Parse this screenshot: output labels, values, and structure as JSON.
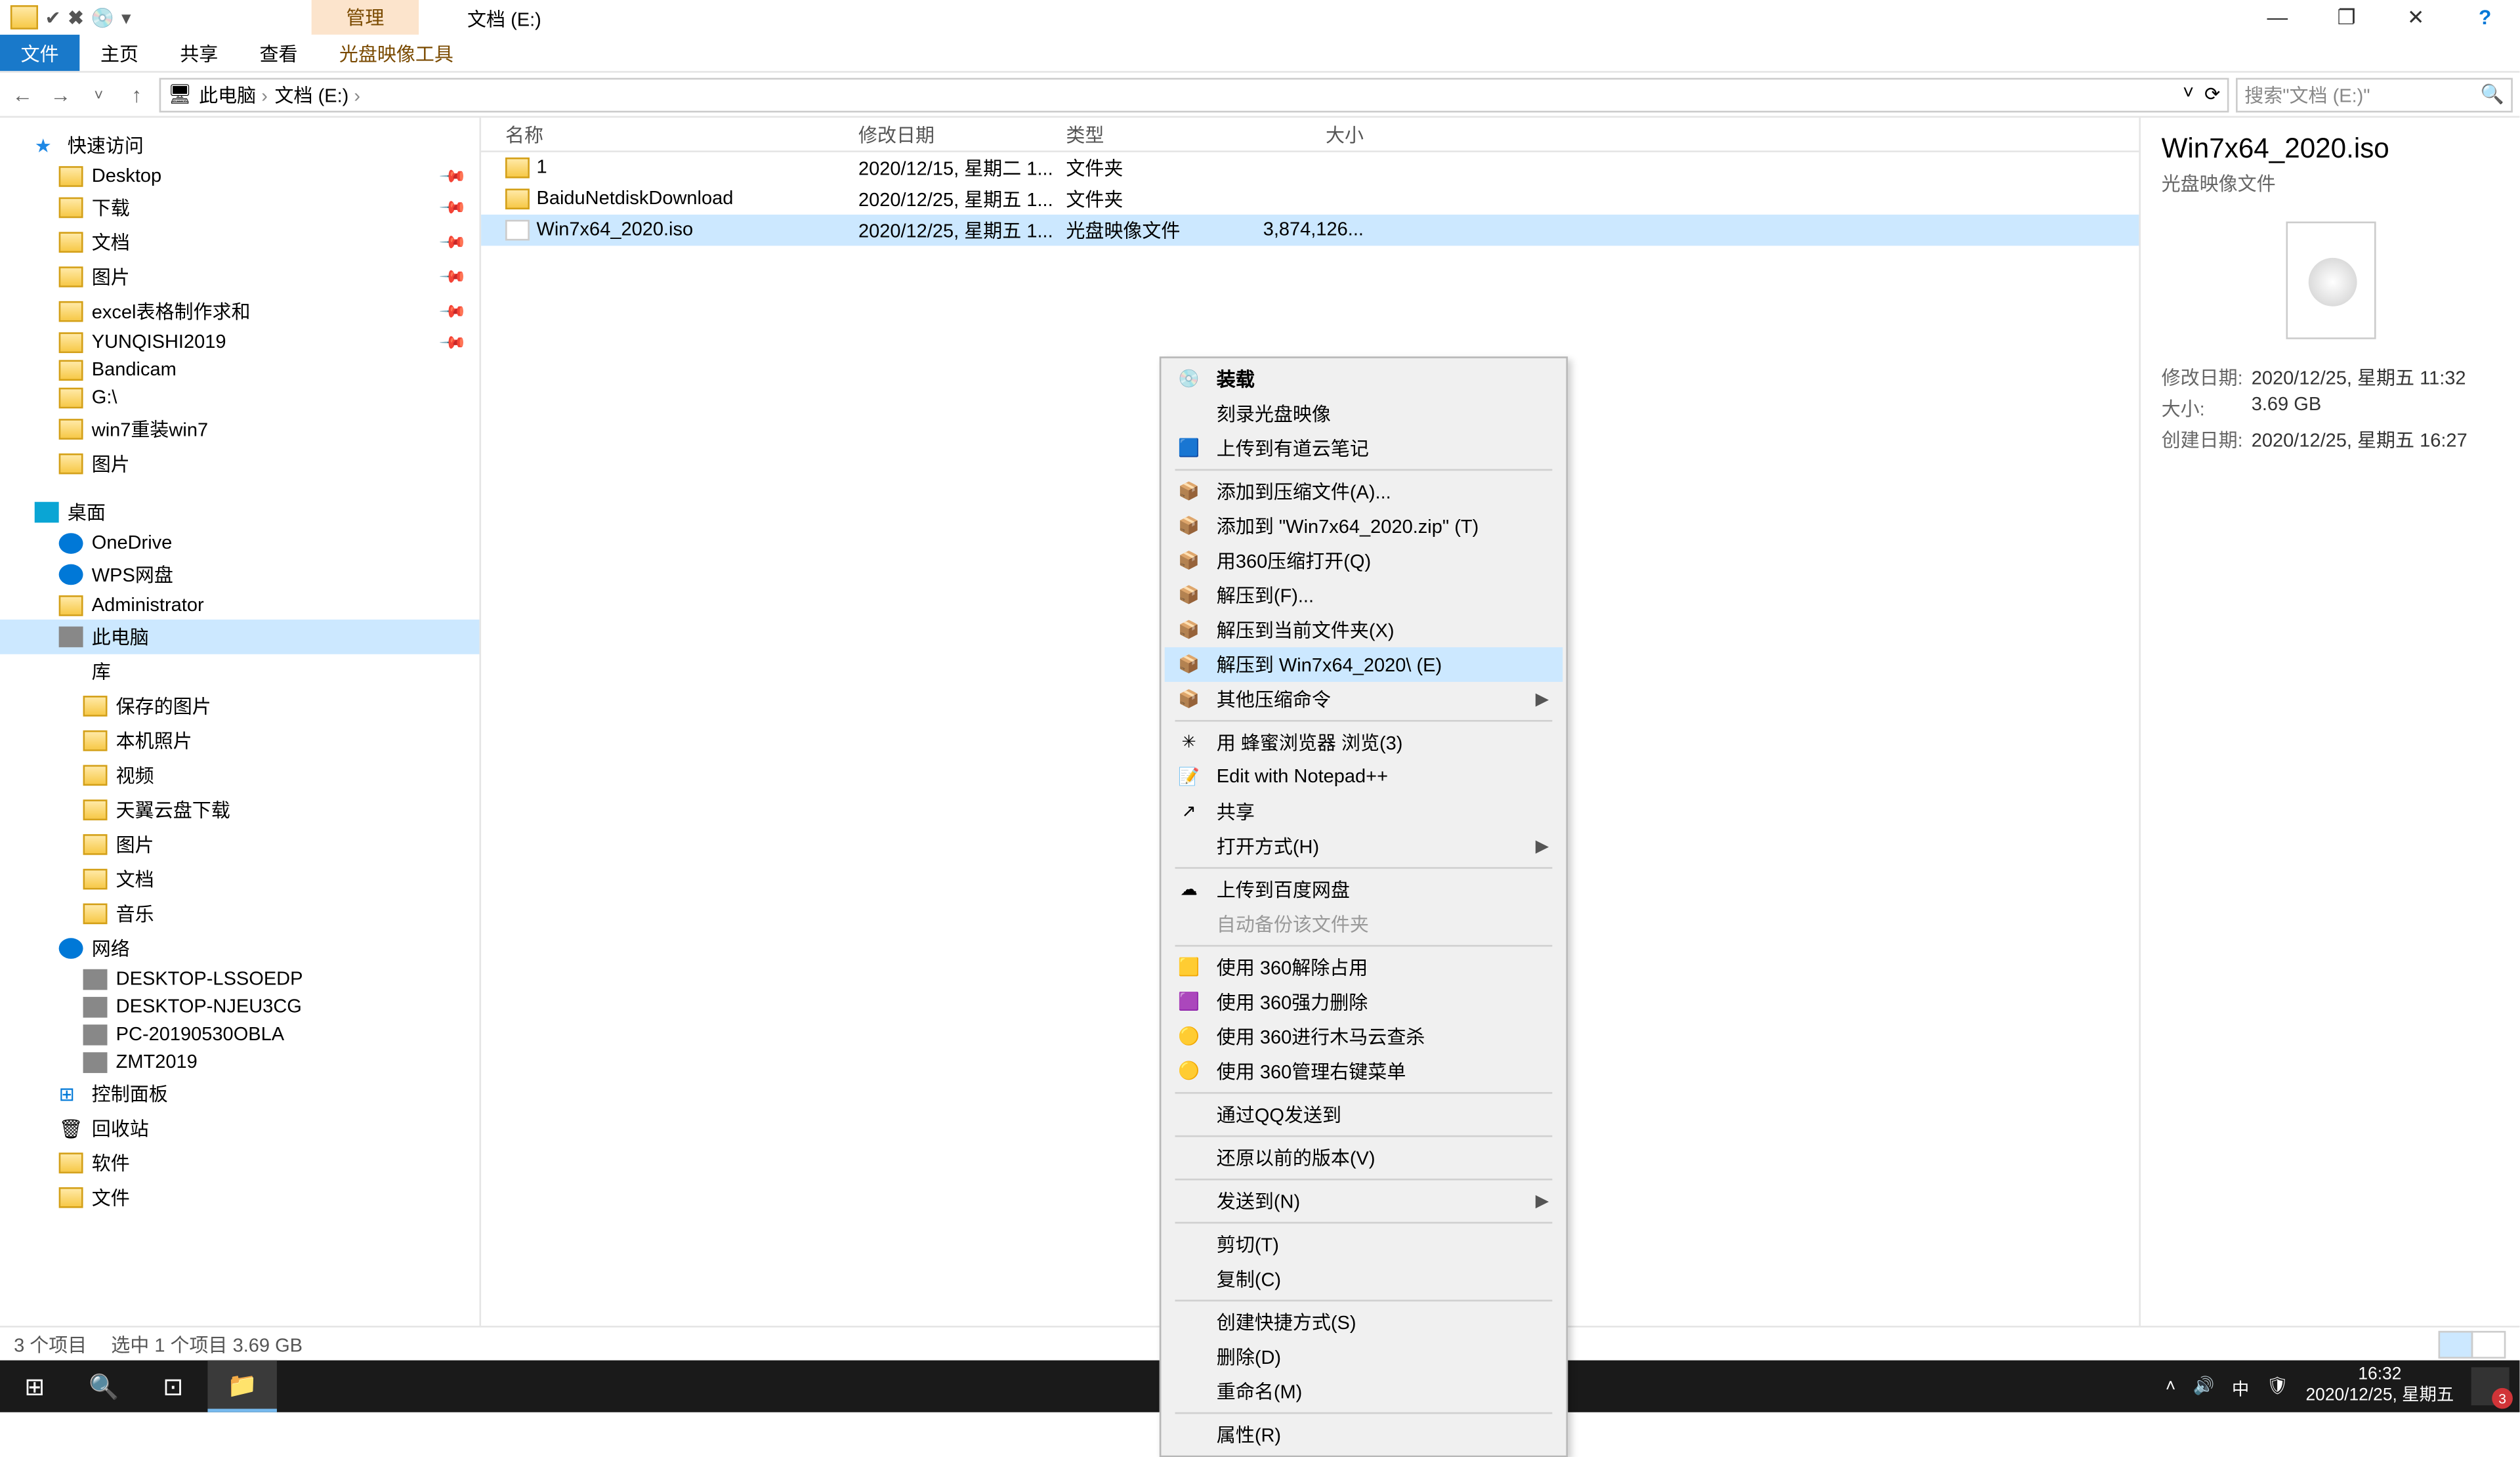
{
  "titlebar": {
    "manage_tab": "管理",
    "title": "文档 (E:)",
    "minimize": "—",
    "maximize": "❐",
    "close": "✕",
    "help": "?"
  },
  "ribbon": {
    "file": "文件",
    "home": "主页",
    "share": "共享",
    "view": "查看",
    "tool": "光盘映像工具"
  },
  "address": {
    "back": "←",
    "forward": "→",
    "up": "↑",
    "crumbs": [
      "此电脑",
      "文档 (E:)"
    ],
    "refresh": "⟳",
    "dropdown": "˅"
  },
  "search": {
    "placeholder": "搜索\"文档 (E:)\""
  },
  "tree": {
    "quick": "快速访问",
    "quick_items": [
      {
        "label": "Desktop",
        "pin": true
      },
      {
        "label": "下载",
        "pin": true
      },
      {
        "label": "文档",
        "pin": true
      },
      {
        "label": "图片",
        "pin": true
      },
      {
        "label": "excel表格制作求和",
        "pin": true
      },
      {
        "label": "YUNQISHI2019",
        "pin": true
      },
      {
        "label": "Bandicam"
      },
      {
        "label": "G:\\"
      },
      {
        "label": "win7重装win7"
      },
      {
        "label": "图片"
      }
    ],
    "desktop": "桌面",
    "desktop_items": [
      {
        "label": "OneDrive",
        "ico": "cloud"
      },
      {
        "label": "WPS网盘",
        "ico": "cloud"
      },
      {
        "label": "Administrator",
        "ico": "fold"
      },
      {
        "label": "此电脑",
        "ico": "pc",
        "sel": true
      },
      {
        "label": "库",
        "ico": "lib"
      }
    ],
    "lib_items": [
      {
        "label": "保存的图片"
      },
      {
        "label": "本机照片"
      },
      {
        "label": "视频"
      },
      {
        "label": "天翼云盘下载"
      },
      {
        "label": "图片"
      },
      {
        "label": "文档"
      },
      {
        "label": "音乐"
      }
    ],
    "network": "网络",
    "net_items": [
      "DESKTOP-LSSOEDP",
      "DESKTOP-NJEU3CG",
      "PC-20190530OBLA",
      "ZMT2019"
    ],
    "panel": "控制面板",
    "recycle": "回收站",
    "soft": "软件",
    "files": "文件"
  },
  "columns": {
    "name": "名称",
    "date": "修改日期",
    "type": "类型",
    "size": "大小"
  },
  "rows": [
    {
      "name": "1",
      "date": "2020/12/15, 星期二 1...",
      "type": "文件夹",
      "size": "",
      "ico": "fold"
    },
    {
      "name": "BaiduNetdiskDownload",
      "date": "2020/12/25, 星期五 1...",
      "type": "文件夹",
      "size": "",
      "ico": "fold"
    },
    {
      "name": "Win7x64_2020.iso",
      "date": "2020/12/25, 星期五 1...",
      "type": "光盘映像文件",
      "size": "3,874,126...",
      "ico": "iso",
      "sel": true
    }
  ],
  "ctx": {
    "items": [
      {
        "label": "装载",
        "bold": true,
        "ico": "💿",
        "sep": false
      },
      {
        "label": "刻录光盘映像"
      },
      {
        "label": "上传到有道云笔记",
        "ico": "🟦"
      },
      {
        "sep": true
      },
      {
        "label": "添加到压缩文件(A)...",
        "ico": "📦"
      },
      {
        "label": "添加到 \"Win7x64_2020.zip\" (T)",
        "ico": "📦"
      },
      {
        "label": "用360压缩打开(Q)",
        "ico": "📦"
      },
      {
        "label": "解压到(F)...",
        "ico": "📦"
      },
      {
        "label": "解压到当前文件夹(X)",
        "ico": "📦"
      },
      {
        "label": "解压到 Win7x64_2020\\ (E)",
        "ico": "📦",
        "hov": true
      },
      {
        "label": "其他压缩命令",
        "ico": "📦",
        "arrow": true
      },
      {
        "sep": true
      },
      {
        "label": "用 蜂蜜浏览器 浏览(3)",
        "ico": "✳"
      },
      {
        "label": "Edit with Notepad++",
        "ico": "📝"
      },
      {
        "label": "共享",
        "ico": "↗"
      },
      {
        "label": "打开方式(H)",
        "arrow": true
      },
      {
        "sep": true
      },
      {
        "label": "上传到百度网盘",
        "ico": "☁"
      },
      {
        "label": "自动备份该文件夹",
        "dis": true
      },
      {
        "sep": true
      },
      {
        "label": "使用 360解除占用",
        "ico": "🟨"
      },
      {
        "label": "使用 360强力删除",
        "ico": "🟪"
      },
      {
        "label": "使用 360进行木马云查杀",
        "ico": "🟡"
      },
      {
        "label": "使用 360管理右键菜单",
        "ico": "🟡"
      },
      {
        "sep": true
      },
      {
        "label": "通过QQ发送到"
      },
      {
        "sep": true
      },
      {
        "label": "还原以前的版本(V)"
      },
      {
        "sep": true
      },
      {
        "label": "发送到(N)",
        "arrow": true
      },
      {
        "sep": true
      },
      {
        "label": "剪切(T)"
      },
      {
        "label": "复制(C)"
      },
      {
        "sep": true
      },
      {
        "label": "创建快捷方式(S)"
      },
      {
        "label": "删除(D)"
      },
      {
        "label": "重命名(M)"
      },
      {
        "sep": true
      },
      {
        "label": "属性(R)"
      }
    ]
  },
  "details": {
    "title": "Win7x64_2020.iso",
    "type": "光盘映像文件",
    "rows": [
      {
        "lab": "修改日期:",
        "val": "2020/12/25, 星期五 11:32"
      },
      {
        "lab": "大小:",
        "val": "3.69 GB"
      },
      {
        "lab": "创建日期:",
        "val": "2020/12/25, 星期五 16:27"
      }
    ]
  },
  "status": {
    "count": "3 个项目",
    "sel": "选中 1 个项目  3.69 GB"
  },
  "taskbar": {
    "time": "16:32",
    "date": "2020/12/25, 星期五",
    "ime": "中",
    "badge": "3"
  }
}
